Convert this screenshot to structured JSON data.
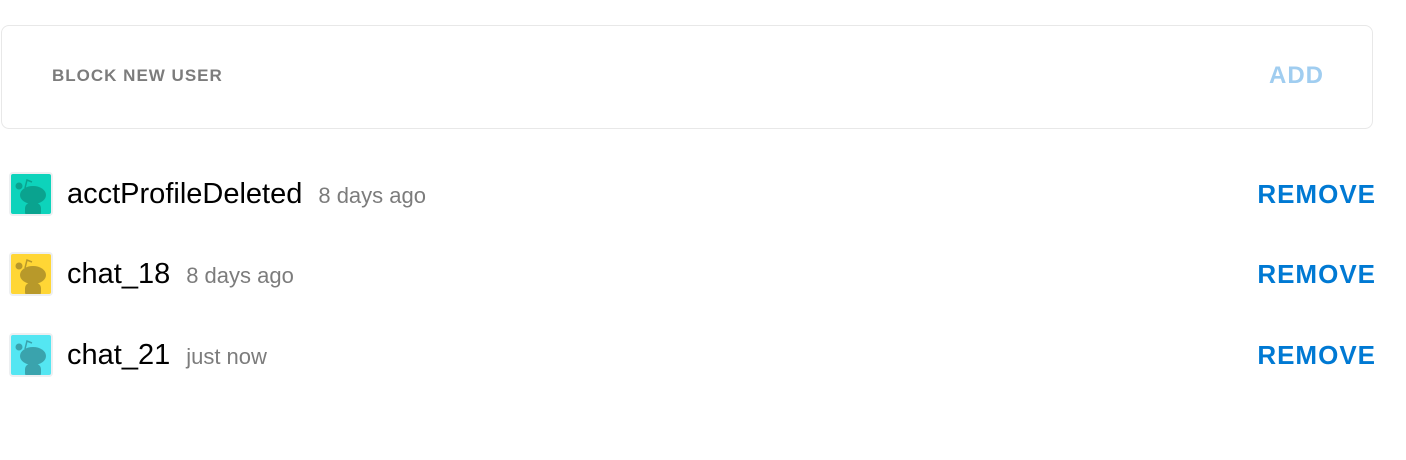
{
  "block_form": {
    "placeholder": "BLOCK NEW USER",
    "value": "",
    "add_label": "ADD"
  },
  "blocked_users": [
    {
      "name": "acctProfileDeleted",
      "time": "8 days ago",
      "avatar_bg": "#0dd3bb",
      "avatar_fg": "#0aa38f",
      "remove_label": "REMOVE"
    },
    {
      "name": "chat_18",
      "time": "8 days ago",
      "avatar_bg": "#ffd635",
      "avatar_fg": "#b8992a",
      "remove_label": "REMOVE"
    },
    {
      "name": "chat_21",
      "time": "just now",
      "avatar_bg": "#54e6f2",
      "avatar_fg": "#3aa3ad",
      "remove_label": "REMOVE"
    }
  ]
}
